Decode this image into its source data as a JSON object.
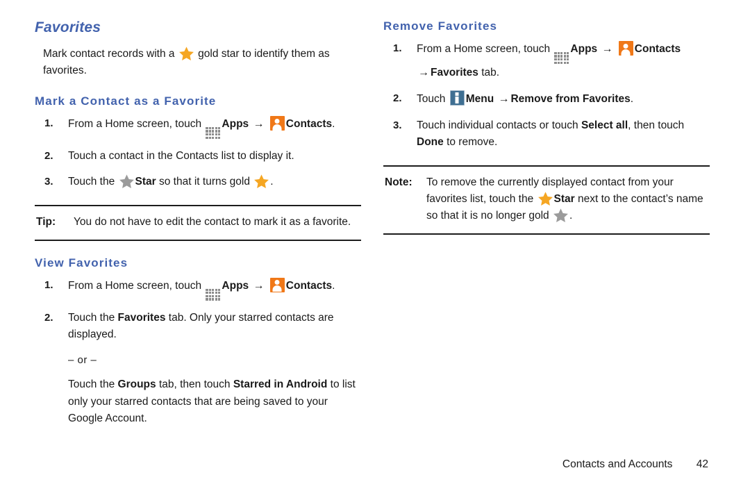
{
  "colors": {
    "heading_blue": "#4262ad",
    "contacts_orange": "#f07818",
    "gold_star": "#f5a623",
    "gray_star": "#9b9b9b",
    "menu_blue": "#3f6f92",
    "rule_black": "#1c1c1c"
  },
  "left_column": {
    "section_title": "Favorites",
    "intro": {
      "before_star": "Mark contact records with a",
      "after_star": "gold star to identify them as favorites."
    },
    "mark_contact": {
      "heading": "Mark a Contact as a Favorite",
      "steps": [
        {
          "num": "1.",
          "text_a": "From a Home screen, touch",
          "apps_label": "Apps",
          "arrow": "→",
          "contacts_label": "Contacts",
          "text_b": "."
        },
        {
          "num": "2.",
          "text_a": "Touch a contact in the Contacts list to display it."
        },
        {
          "num": "3.",
          "text_a": "Touch the",
          "star_label": "Star",
          "text_b": "so that it turns gold",
          "text_c": "."
        }
      ]
    },
    "tip": {
      "tag": "Tip:",
      "text": "You do not have to edit the contact to mark it as a favorite."
    },
    "view_favorites": {
      "heading": "View Favorites",
      "steps": [
        {
          "num": "1.",
          "text_a": "From a Home screen, touch",
          "apps_label": "Apps",
          "arrow": "→",
          "contacts_label": "Contacts",
          "text_b": "."
        },
        {
          "num": "2.",
          "text_a": "Touch the",
          "bold_a": "Favorites",
          "text_b": "tab. Only your starred contacts are displayed.",
          "or_divider": "– or –",
          "alt_text_a": "Touch the",
          "alt_bold_a": "Groups",
          "alt_text_b": "tab, then touch",
          "alt_bold_b": "Starred in Android",
          "alt_text_c": "to list only your starred contacts that are being saved to your Google Account."
        }
      ]
    }
  },
  "right_column": {
    "remove_favorites": {
      "heading": "Remove Favorites",
      "steps": [
        {
          "num": "1.",
          "text_a": "From a Home screen, touch",
          "apps_label": "Apps",
          "arrow": "→",
          "contacts_label": "Contacts",
          "arrow2": "→",
          "bold_b": "Favorites",
          "text_b": "tab."
        },
        {
          "num": "2.",
          "text_a": "Touch",
          "menu_label": "Menu",
          "arrow": "→",
          "bold_b": "Remove from Favorites",
          "text_b": "."
        },
        {
          "num": "3.",
          "text_a": "Touch individual contacts or touch",
          "bold_a": "Select all",
          "text_b": ", then touch",
          "bold_b": "Done",
          "text_c": "to remove."
        }
      ]
    },
    "note": {
      "tag": "Note:",
      "text_a": "To remove the currently displayed contact from your favorites list, touch the",
      "bold_a": "Star",
      "text_b": "next to the contact’s name so that it is no longer gold",
      "text_c": "."
    }
  },
  "footer": {
    "chapter": "Contacts and Accounts",
    "page_number": "42"
  }
}
